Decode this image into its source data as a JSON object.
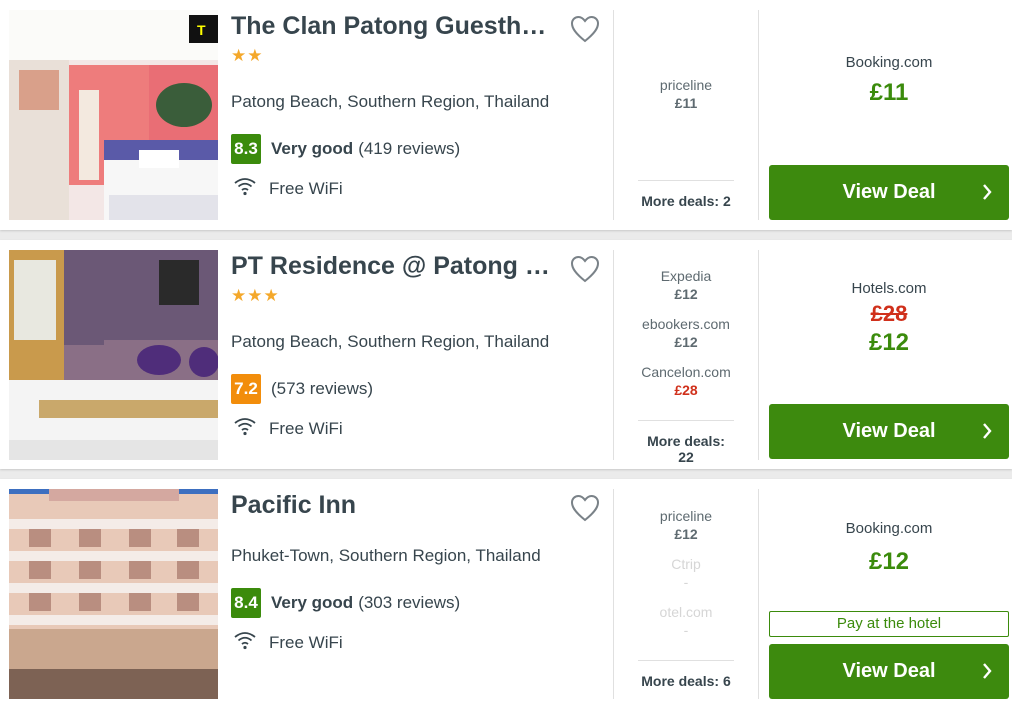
{
  "hotels": [
    {
      "name": "The Clan Patong Guesth…",
      "stars": "★★",
      "location": "Patong Beach, Southern Region, Thailand",
      "score": "8.3",
      "rating_label": "Very good",
      "reviews": "(419 reviews)",
      "amenity": "Free WiFi",
      "deals": [
        {
          "site": "priceline",
          "price": "£11"
        }
      ],
      "more_deals": "More deals: 2",
      "best_site": "Booking.com",
      "best_price": "£11",
      "view_deal": "View Deal"
    },
    {
      "name": "PT Residence @ Patong …",
      "stars": "★★★",
      "location": "Patong Beach, Southern Region, Thailand",
      "score": "7.2",
      "rating_label": "",
      "reviews": "(573 reviews)",
      "amenity": "Free WiFi",
      "deals": [
        {
          "site": "Expedia",
          "price": "£12"
        },
        {
          "site": "ebookers.com",
          "price": "£12"
        },
        {
          "site": "Cancelon.com",
          "price": "£28"
        }
      ],
      "more_deals": "More deals: 22",
      "best_site": "Hotels.com",
      "best_old_price": "£28",
      "best_price": "£12",
      "view_deal": "View Deal"
    },
    {
      "name": "Pacific Inn",
      "stars": "",
      "location": "Phuket-Town, Southern Region, Thailand",
      "score": "8.4",
      "rating_label": "Very good",
      "reviews": "(303 reviews)",
      "amenity": "Free WiFi",
      "deals": [
        {
          "site": "priceline",
          "price": "£12"
        },
        {
          "site": "Ctrip",
          "price": "-"
        },
        {
          "site": "otel.com",
          "price": "-"
        }
      ],
      "more_deals": "More deals: 6",
      "best_site": "Booking.com",
      "best_price": "£12",
      "pay_at_hotel": "Pay at the hotel",
      "view_deal": "View Deal"
    }
  ],
  "colors": {
    "green": "#3b8b0c",
    "orange": "#f28d0b",
    "red": "#d0301b",
    "star": "#f4a82b"
  },
  "icons": [
    "heart-outline-icon",
    "wifi-icon",
    "chevron-right-icon"
  ]
}
